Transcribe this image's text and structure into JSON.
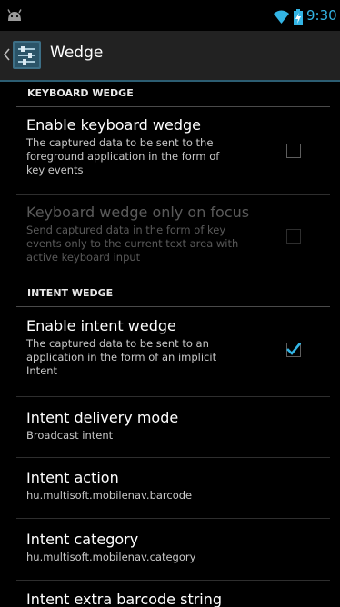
{
  "status_bar": {
    "time": "9:30",
    "icons": [
      "android-icon",
      "wifi-icon",
      "battery-icon"
    ],
    "accent_color": "#33b5e5"
  },
  "action_bar": {
    "title": "Wedge",
    "icons": [
      "up-icon",
      "settings-app-icon"
    ]
  },
  "sections": {
    "keyboard_wedge": "KEYBOARD WEDGE",
    "intent_wedge": "INTENT WEDGE"
  },
  "prefs": {
    "enable_keyboard_wedge": {
      "title": "Enable keyboard wedge",
      "summary_lines": [
        "The captured data to be sent to the",
        "foreground application in the form of",
        "key events"
      ],
      "checked": false,
      "enabled": true
    },
    "keyboard_wedge_focus": {
      "title": "Keyboard wedge only on focus",
      "summary_lines": [
        "Send captured data in the form of key",
        "events only to the current text area with",
        "active keyboard input"
      ],
      "checked": false,
      "enabled": false
    },
    "enable_intent_wedge": {
      "title": "Enable intent wedge",
      "summary_lines": [
        "The captured data to be sent to an",
        "application in the form of an implicit",
        "Intent"
      ],
      "checked": true,
      "enabled": true
    },
    "intent_delivery_mode": {
      "title": "Intent delivery mode",
      "summary": "Broadcast intent"
    },
    "intent_action": {
      "title": "Intent action",
      "summary": "hu.multisoft.mobilenav.barcode"
    },
    "intent_category": {
      "title": "Intent category",
      "summary": "hu.multisoft.mobilenav.category"
    },
    "intent_extra_barcode": {
      "title": "Intent extra barcode string"
    }
  },
  "colors": {
    "checkbox_check": "#33b5e5",
    "disabled_text": "#5a5a5a"
  }
}
